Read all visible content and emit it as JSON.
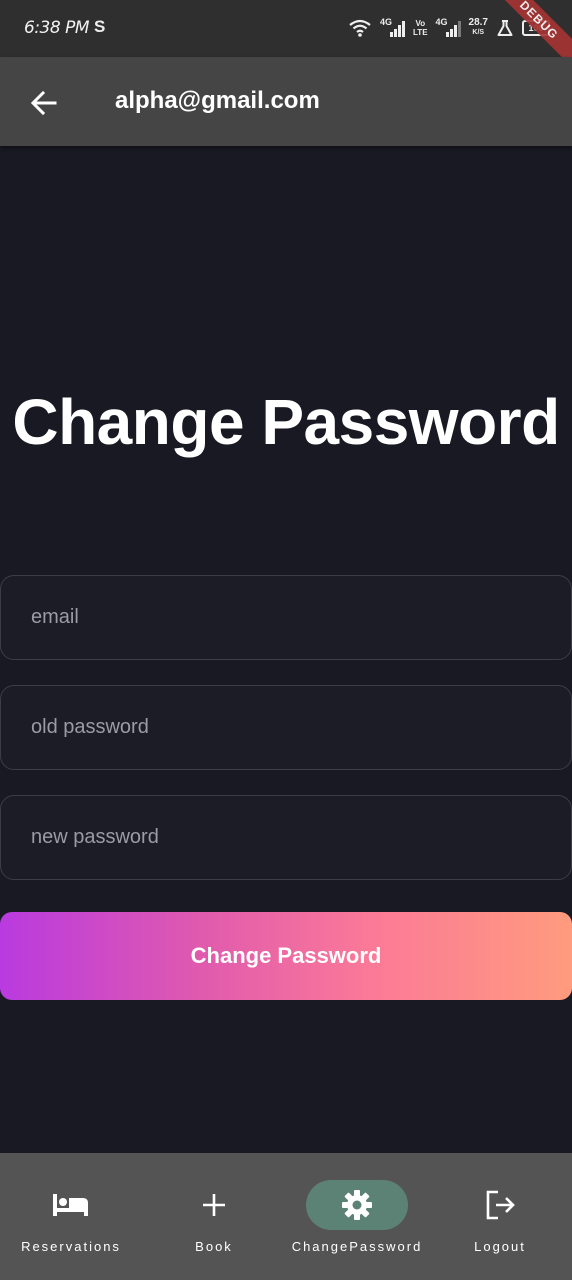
{
  "status_bar": {
    "time": "6:38 PM",
    "extra_icon": "S",
    "net1_label": "4G",
    "volte_top": "Vo",
    "volte_bottom": "LTE",
    "net2_label": "4G",
    "speed_value": "28.7",
    "speed_unit": "K/S",
    "battery": "100",
    "debug": "DEBUG"
  },
  "app_bar": {
    "title": "alpha@gmail.com",
    "back_icon": "arrow-left-icon"
  },
  "page": {
    "heading": "Change Password"
  },
  "form": {
    "email_placeholder": "email",
    "old_password_placeholder": "old password",
    "new_password_placeholder": "new password",
    "submit_label": "Change Password"
  },
  "bottom_nav": {
    "items": [
      {
        "label": "Reservations",
        "icon": "bed-icon"
      },
      {
        "label": "Book",
        "icon": "plus-icon"
      },
      {
        "label": "ChangePassword",
        "icon": "gear-icon",
        "active": true
      },
      {
        "label": "Logout",
        "icon": "logout-icon"
      }
    ]
  },
  "colors": {
    "background": "#181922",
    "app_bar": "#454545",
    "nav_bar": "#545454",
    "active_pill": "#5b8275",
    "gradient_start": "#b93ae0",
    "gradient_end": "#ff9b7e"
  }
}
